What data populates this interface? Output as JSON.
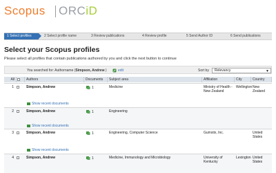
{
  "header": {
    "logo_scopus": "Scopus",
    "logo_orcid_prefix": "ORC",
    "logo_orcid_suffix": "iD"
  },
  "steps": [
    {
      "label": "1 Select profiles",
      "active": true
    },
    {
      "label": "2 Select profile name",
      "active": false
    },
    {
      "label": "3 Review publications",
      "active": false
    },
    {
      "label": "4 Review profile",
      "active": false
    },
    {
      "label": "5 Send Author ID",
      "active": false
    },
    {
      "label": "6 Send publications",
      "active": false
    }
  ],
  "page": {
    "title": "Select your Scopus profiles",
    "subtitle": "Please select all profiles that contain publications authored by you and click the next button to continue"
  },
  "search": {
    "prefix": "You searched for: Authorname (",
    "query": "Simpson, Andrew",
    "suffix": " )",
    "edit_label": "edit",
    "sort_label": "Sort by",
    "sort_value": "Relevancy"
  },
  "table": {
    "headers": {
      "all": "All",
      "authors": "Authors",
      "documents": "Documents",
      "subject_area": "Subject area",
      "affiliation": "Affiliation",
      "city": "City",
      "country": "Country"
    },
    "show_recent_label": "Show recent documents",
    "rows": [
      {
        "index": "1",
        "author": "Simpson, Andrew",
        "documents": "1",
        "subject": "Medicine",
        "affiliation": "Ministry of Health - New Zealand",
        "city": "Wellington",
        "country": "New Zealand"
      },
      {
        "index": "2",
        "author": "Simpson, Andrew",
        "documents": "1",
        "subject": "Engineering",
        "affiliation": "",
        "city": "",
        "country": ""
      },
      {
        "index": "3",
        "author": "Simpson, Andrew",
        "documents": "1",
        "subject": "Engineering, Computer Science",
        "affiliation": "Gumstix, Inc.",
        "city": "",
        "country": "United States"
      },
      {
        "index": "4",
        "author": "Simpson, Andrew",
        "documents": "1",
        "subject": "Medicine, Immunology and Microbiology",
        "affiliation": "University of Kentucky",
        "city": "Lexington",
        "country": "United States"
      }
    ]
  },
  "colors": {
    "scopus_orange": "#f07c2b",
    "orcid_green": "#a6ce39",
    "active_step_blue": "#3571b4",
    "link_blue": "#3571b4"
  }
}
